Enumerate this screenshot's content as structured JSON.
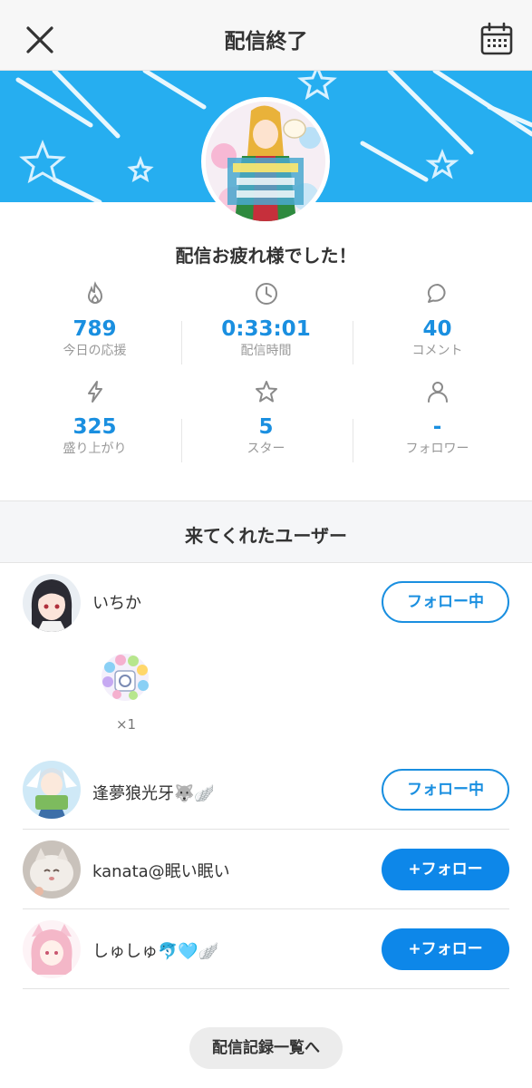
{
  "header": {
    "title": "配信終了",
    "close_icon": "close-icon",
    "calendar_icon": "calendar-icon"
  },
  "summary": {
    "message": "配信お疲れ様でした！"
  },
  "stats": [
    {
      "icon": "flame-icon",
      "value": "789",
      "label": "今日の応援"
    },
    {
      "icon": "clock-icon",
      "value": "0:33:01",
      "label": "配信時間"
    },
    {
      "icon": "comment-icon",
      "value": "40",
      "label": "コメント"
    },
    {
      "icon": "lightning-icon",
      "value": "325",
      "label": "盛り上がり"
    },
    {
      "icon": "star-icon",
      "value": "5",
      "label": "スター"
    },
    {
      "icon": "person-icon",
      "value": "-",
      "label": "フォロワー"
    }
  ],
  "visitors": {
    "title": "来てくれたユーザー",
    "users": [
      {
        "name": "いちか",
        "button": "フォロー中",
        "following": true,
        "gift_count": "×1"
      },
      {
        "name": "逢夢狼光牙🐺🪽",
        "button": "フォロー中",
        "following": true
      },
      {
        "name": "kanata@眠い眠い",
        "button": "+フォロー",
        "following": false
      },
      {
        "name": "しゅしゅ🐬🩵🪽",
        "button": "+フォロー",
        "following": false
      }
    ]
  },
  "footer": {
    "history_button": "配信記録一覧へ"
  },
  "colors": {
    "accent": "#1a8fe0",
    "banner": "#26aef0",
    "follow_button": "#0d87e9"
  }
}
